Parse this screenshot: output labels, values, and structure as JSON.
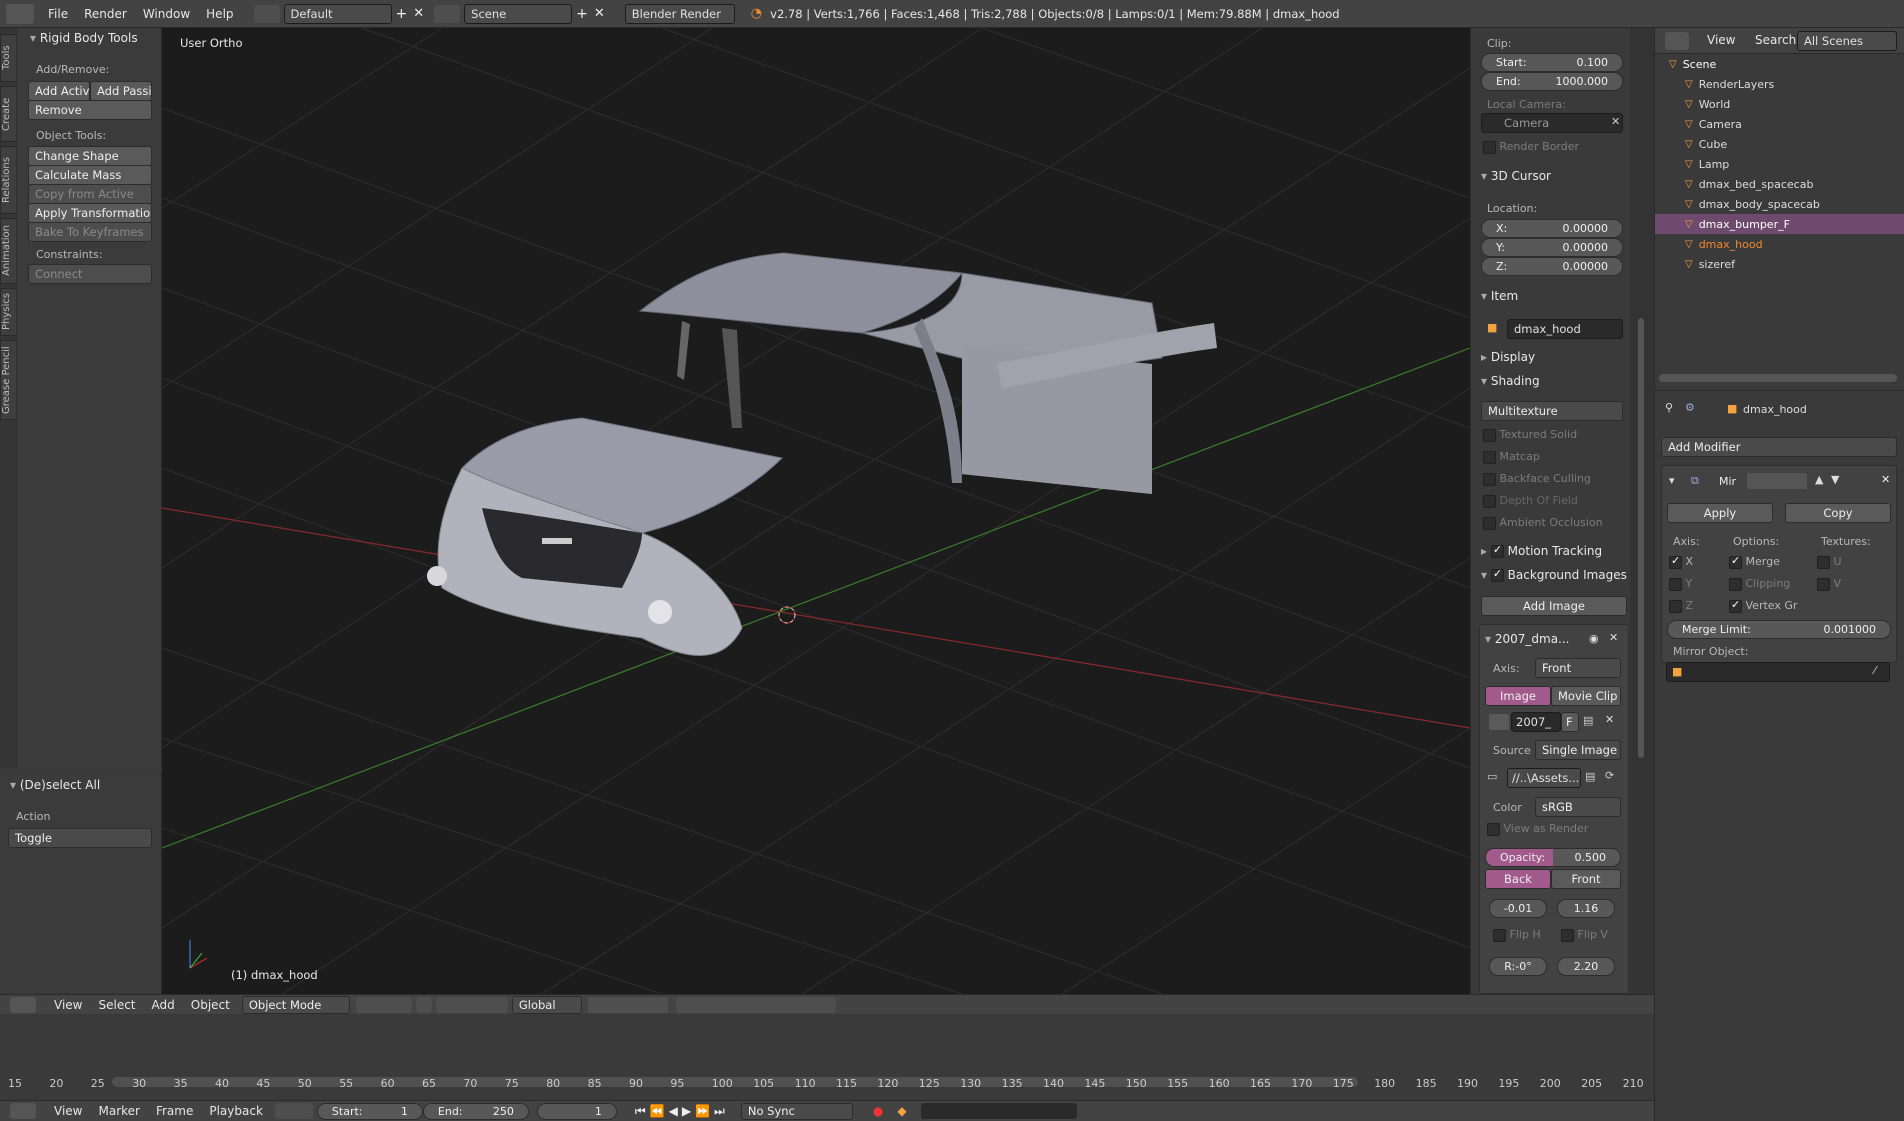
{
  "topbar": {
    "menus": [
      "File",
      "Render",
      "Window",
      "Help"
    ],
    "layout": "Default",
    "scene": "Scene",
    "engine": "Blender Render",
    "stats": "v2.78 | Verts:1,766 | Faces:1,468 | Tris:2,788 | Objects:0/8 | Lamps:0/1 | Mem:79.88M | dmax_hood"
  },
  "tabs": [
    "Tools",
    "Create",
    "Relations",
    "Animation",
    "Physics",
    "Grease Pencil"
  ],
  "tools": {
    "panel": "Rigid Body Tools",
    "add_remove": "Add/Remove:",
    "add_active": "Add Activ",
    "add_passive": "Add Passiv",
    "remove": "Remove",
    "object_tools": "Object Tools:",
    "change_shape": "Change Shape",
    "calc_mass": "Calculate Mass",
    "copy_active": "Copy from Active",
    "apply_transform": "Apply Transformation",
    "bake": "Bake To Keyframes",
    "constraints": "Constraints:",
    "connect": "Connect",
    "deselect": "(De)select All",
    "action": "Action",
    "toggle": "Toggle"
  },
  "viewport": {
    "view_name": "User Ortho",
    "object_label": "(1) dmax_hood"
  },
  "props": {
    "clip": "Clip:",
    "start_l": "Start:",
    "start_v": "0.100",
    "end_l": "End:",
    "end_v": "1000.000",
    "local_camera": "Local Camera:",
    "camera": "Camera",
    "render_border": "Render Border",
    "cursor": "3D Cursor",
    "location": "Location:",
    "x_l": "X:",
    "x_v": "0.00000",
    "y_l": "Y:",
    "y_v": "0.00000",
    "z_l": "Z:",
    "z_v": "0.00000",
    "item": "Item",
    "item_name": "dmax_hood",
    "display": "Display",
    "shading": "Shading",
    "shade_mode": "Multitexture",
    "textured_solid": "Textured Solid",
    "matcap": "Matcap",
    "backface": "Backface Culling",
    "dof": "Depth Of Field",
    "ao": "Ambient Occlusion",
    "motion": "Motion Tracking",
    "bg_images": "Background Images",
    "add_image": "Add Image",
    "bg_name": "2007_dma...",
    "axis_l": "Axis:",
    "axis_v": "Front",
    "image_tab": "Image",
    "movie_tab": "Movie Clip",
    "img_field": "2007_",
    "img_f": "F",
    "source_l": "Source",
    "source_v": "Single Image",
    "path": "//..\\Assets...",
    "color_l": "Color",
    "color_v": "sRGB",
    "view_render": "View as Render",
    "opacity_l": "Opacity:",
    "opacity_v": "0.500",
    "back": "Back",
    "front": "Front",
    "ox": "-0.01",
    "oy": "1.16",
    "flip_h": "Flip H",
    "flip_v": "Flip V",
    "rot": "R:-0°",
    "size": "2.20"
  },
  "outliner": {
    "menus": [
      "View",
      "Search",
      "All Scenes"
    ],
    "rows": [
      {
        "name": "Scene",
        "indent": 0,
        "color": "#ffffff"
      },
      {
        "name": "RenderLayers",
        "indent": 1,
        "color": "#dddddd"
      },
      {
        "name": "World",
        "indent": 1,
        "color": "#dddddd"
      },
      {
        "name": "Camera",
        "indent": 1,
        "color": "#dddddd"
      },
      {
        "name": "Cube",
        "indent": 1,
        "color": "#dddddd"
      },
      {
        "name": "Lamp",
        "indent": 1,
        "color": "#dddddd"
      },
      {
        "name": "dmax_bed_spacecab",
        "indent": 1,
        "color": "#dddddd"
      },
      {
        "name": "dmax_body_spacecab",
        "indent": 1,
        "color": "#dddddd"
      },
      {
        "name": "dmax_bumper_F",
        "indent": 1,
        "color": "#ffffff"
      },
      {
        "name": "dmax_hood",
        "indent": 1,
        "color": "#f28a2e"
      },
      {
        "name": "sizeref",
        "indent": 1,
        "color": "#dddddd"
      }
    ]
  },
  "modifier": {
    "object": "dmax_hood",
    "add_modifier": "Add Modifier",
    "name": "Mir",
    "apply": "Apply",
    "copy": "Copy",
    "axis": "Axis:",
    "options": "Options:",
    "textures": "Textures:",
    "x": "X",
    "y": "Y",
    "z": "Z",
    "merge": "Merge",
    "clipping": "Clipping",
    "vertex": "Vertex Gr",
    "u": "U",
    "v": "V",
    "merge_limit_l": "Merge Limit:",
    "merge_limit_v": "0.001000",
    "mirror_obj": "Mirror Object:"
  },
  "view3d_header": {
    "menus": [
      "View",
      "Select",
      "Add",
      "Object"
    ],
    "mode": "Object Mode",
    "orientation": "Global"
  },
  "timeline": {
    "ticks": [
      "15",
      "20",
      "25",
      "30",
      "35",
      "40",
      "45",
      "50",
      "55",
      "60",
      "65",
      "70",
      "75",
      "80",
      "85",
      "90",
      "95",
      "100",
      "105",
      "110",
      "115",
      "120",
      "125",
      "130",
      "135",
      "140",
      "145",
      "150",
      "155",
      "160",
      "165",
      "170",
      "175",
      "180",
      "185",
      "190",
      "195",
      "200",
      "205",
      "210"
    ],
    "menus": [
      "View",
      "Marker",
      "Frame",
      "Playback"
    ],
    "start_l": "Start:",
    "start_v": "1",
    "end_l": "End:",
    "end_v": "250",
    "current": "1",
    "sync": "No Sync"
  },
  "colors": {
    "accent": "#c9a0c6",
    "pink_btn": "#a25a8d",
    "orange": "#f28a2e"
  }
}
